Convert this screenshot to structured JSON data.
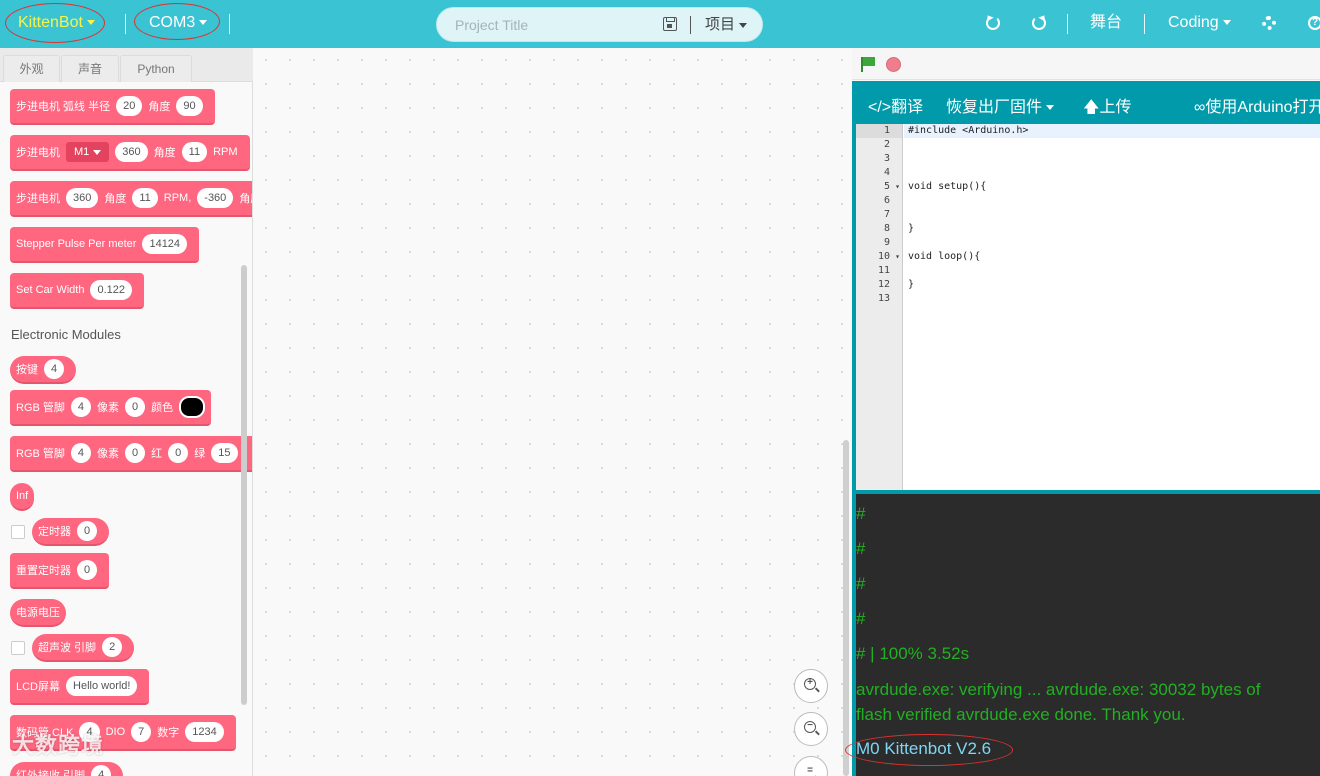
{
  "topbar": {
    "brand": "KittenBot",
    "port": "COM3",
    "project_title_placeholder": "Project Title",
    "project_menu": "项目",
    "stage": "舞台",
    "mode": "Coding"
  },
  "palette": {
    "tabs": [
      "外观",
      "声音",
      "Python"
    ],
    "blocks": {
      "b1": {
        "label": "步进电机 弧线 半径",
        "v1": "20",
        "l2": "角度",
        "v2": "90"
      },
      "b2": {
        "label": "步进电机",
        "dd": "M1",
        "v1": "360",
        "l2": "角度",
        "v2": "11",
        "l3": "RPM"
      },
      "b3": {
        "label": "步进电机",
        "v1": "360",
        "l2": "角度",
        "v2": "11",
        "l3": "RPM,",
        "v3": "-360",
        "l4": "角度"
      },
      "b4": {
        "label": "Stepper Pulse Per meter",
        "v1": "14124"
      },
      "b5": {
        "label": "Set Car Width",
        "v1": "0.122"
      },
      "category": "Electronic Modules",
      "b6": {
        "label": "按键",
        "v1": "4"
      },
      "b7": {
        "label": "RGB 管脚",
        "v1": "4",
        "l2": "像素",
        "v2": "0",
        "l3": "颜色"
      },
      "b8": {
        "label": "RGB 管脚",
        "v1": "4",
        "l2": "像素",
        "v2": "0",
        "l3": "红",
        "v3": "0",
        "l4": "绿",
        "v4": "15"
      },
      "b9": {
        "label": "Inf"
      },
      "b10": {
        "label": "定时器",
        "v1": "0"
      },
      "b11": {
        "label": "重置定时器",
        "v1": "0"
      },
      "b12": {
        "label": "电源电压"
      },
      "b13": {
        "label": "超声波 引脚",
        "v1": "2"
      },
      "b14": {
        "label": "LCD屏幕",
        "v1": "Hello world!"
      },
      "b15": {
        "label": "数码管 CLK",
        "v1": "4",
        "l2": "DIO",
        "v2": "7",
        "l3": "数字",
        "v3": "1234"
      },
      "b16": {
        "label": "红外接收 引脚",
        "v1": "4"
      }
    }
  },
  "code_toolbar": {
    "translate": "翻译",
    "restore_firmware": "恢复出厂固件",
    "upload": "上传",
    "open_arduino": "使用Arduino打开"
  },
  "code": {
    "line_numbers": [
      "1",
      "2",
      "3",
      "4",
      "5",
      "6",
      "7",
      "8",
      "9",
      "10",
      "11",
      "12",
      "13"
    ],
    "l1": "#include <Arduino.h>",
    "l5": "void setup(){",
    "l8": "}",
    "l10": "void loop(){",
    "l12": "}"
  },
  "console": {
    "hash": "#",
    "progress": "# | 100% 3.52s",
    "verify": " avrdude.exe: verifying ... avrdude.exe: 30032 bytes of flash verified  avrdude.exe done. Thank you.",
    "version": "M0 Kittenbot V2.6"
  },
  "watermark": "大数跨境",
  "colors": {
    "topbar": "#39c3d3",
    "block": "#ff6680",
    "code_panel": "#009aaa",
    "console_bg": "#2b2b2b",
    "console_text": "#21b021",
    "brand": "#f7f34a"
  }
}
